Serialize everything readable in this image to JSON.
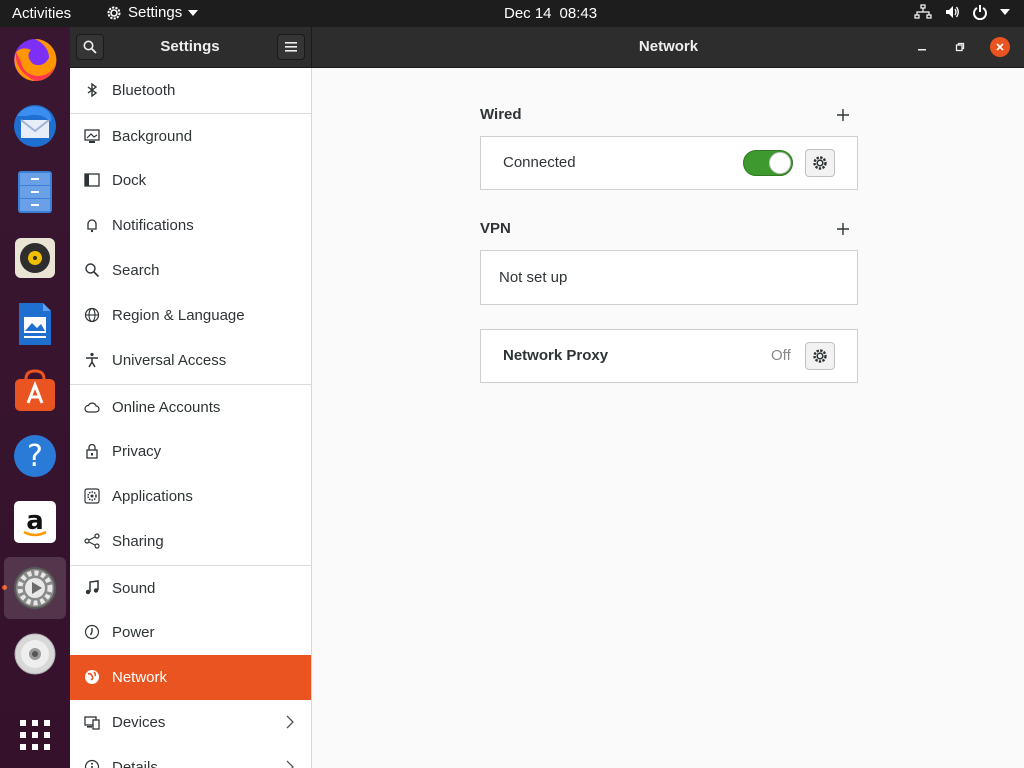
{
  "topbar": {
    "activities": "Activities",
    "app_menu": "Settings",
    "date": "Dec 14",
    "time": "08:43"
  },
  "dock": {
    "items": [
      {
        "name": "firefox-icon",
        "running": false
      },
      {
        "name": "thunderbird-icon",
        "running": false
      },
      {
        "name": "files-icon",
        "running": false
      },
      {
        "name": "rhythmbox-icon",
        "running": false
      },
      {
        "name": "libreoffice-writer-icon",
        "running": false
      },
      {
        "name": "ubuntu-software-icon",
        "running": false
      },
      {
        "name": "help-icon",
        "running": false
      },
      {
        "name": "amazon-icon",
        "running": false
      },
      {
        "name": "settings-icon",
        "running": true
      },
      {
        "name": "dvd-icon",
        "running": false
      },
      {
        "name": "show-applications-icon",
        "running": false
      }
    ]
  },
  "window": {
    "sidebar_title": "Settings",
    "title": "Network"
  },
  "sidebar": {
    "items": [
      {
        "label": "Bluetooth",
        "icon": "bluetooth-icon"
      },
      {
        "label": "Background",
        "icon": "background-icon"
      },
      {
        "label": "Dock",
        "icon": "dock-icon"
      },
      {
        "label": "Notifications",
        "icon": "bell-icon"
      },
      {
        "label": "Search",
        "icon": "search-icon"
      },
      {
        "label": "Region & Language",
        "icon": "globe-icon"
      },
      {
        "label": "Universal Access",
        "icon": "accessibility-icon"
      },
      {
        "label": "Online Accounts",
        "icon": "cloud-icon"
      },
      {
        "label": "Privacy",
        "icon": "lock-icon"
      },
      {
        "label": "Applications",
        "icon": "applications-icon"
      },
      {
        "label": "Sharing",
        "icon": "share-icon"
      },
      {
        "label": "Sound",
        "icon": "music-note-icon"
      },
      {
        "label": "Power",
        "icon": "power-icon"
      },
      {
        "label": "Network",
        "icon": "network-icon",
        "selected": true
      },
      {
        "label": "Devices",
        "icon": "devices-icon",
        "has_submenu": true
      },
      {
        "label": "Details",
        "icon": "info-icon",
        "has_submenu": true
      }
    ]
  },
  "network": {
    "wired": {
      "title": "Wired",
      "status": "Connected",
      "enabled": true
    },
    "vpn": {
      "title": "VPN",
      "status": "Not set up"
    },
    "proxy": {
      "title": "Network Proxy",
      "status": "Off"
    }
  },
  "colors": {
    "accent": "#e95420",
    "toggle_on": "#3e9a2e",
    "headerbar": "#2d2d2d",
    "topbar": "#1d1d1d"
  }
}
